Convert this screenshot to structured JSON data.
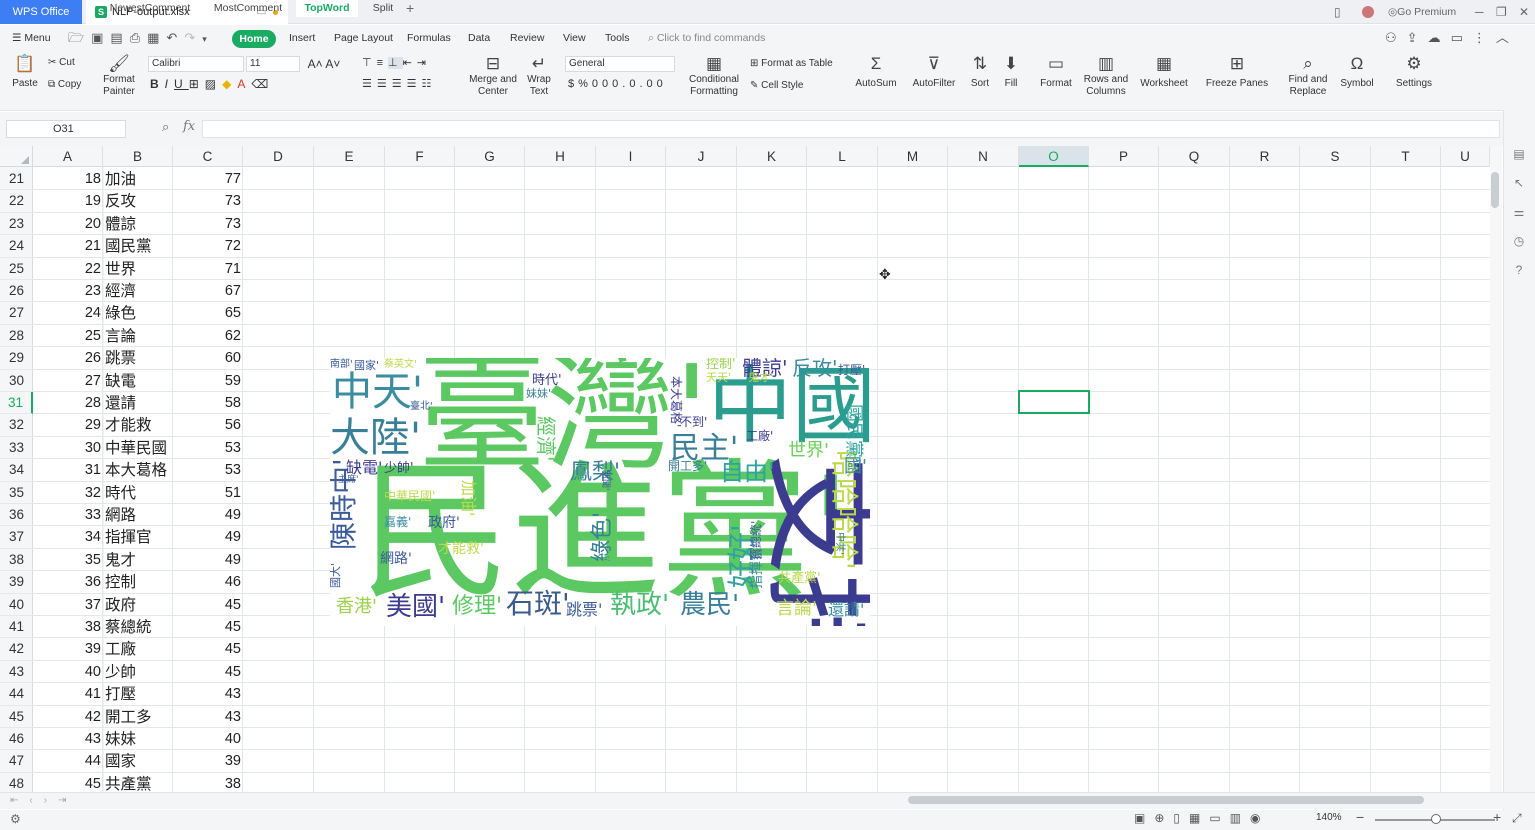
{
  "titlebar": {
    "app_name": "WPS Office",
    "doc_name": "NLP-output.xlsx",
    "new_tab": "+",
    "premium": "Go Premium",
    "win_min": "─",
    "win_max": "❐",
    "win_close": "✕"
  },
  "menubar": {
    "menu_label": "Menu",
    "tabs": [
      "Home",
      "Insert",
      "Page Layout",
      "Formulas",
      "Data",
      "Review",
      "View",
      "Tools"
    ],
    "search_placeholder": "Click to find commands"
  },
  "ribbon": {
    "paste": "Paste",
    "cut": "Cut",
    "copy": "Copy",
    "format_painter_1": "Format",
    "format_painter_2": "Painter",
    "font_name": "Calibri",
    "font_size": "11",
    "bold": "B",
    "italic": "I",
    "underline": "U",
    "merge_1": "Merge and",
    "merge_2": "Center",
    "wrap_1": "Wrap",
    "wrap_2": "Text",
    "number_format": "General",
    "cond_fmt_1": "Conditional",
    "cond_fmt_2": "Formatting",
    "format_as_table": "Format as Table",
    "cell_style": "Cell Style",
    "autosum": "AutoSum",
    "autofilter": "AutoFilter",
    "sort": "Sort",
    "fill": "Fill",
    "format": "Format",
    "rows_cols_1": "Rows and",
    "rows_cols_2": "Columns",
    "worksheet": "Worksheet",
    "freeze": "Freeze Panes",
    "find_1": "Find and",
    "find_2": "Replace",
    "symbol": "Symbol",
    "settings": "Settings"
  },
  "formula_bar": {
    "name_box": "O31",
    "fx": "fx",
    "formula": ""
  },
  "columns": [
    "A",
    "B",
    "C",
    "D",
    "E",
    "F",
    "G",
    "H",
    "I",
    "J",
    "K",
    "L",
    "M",
    "N",
    "O",
    "P",
    "Q",
    "R",
    "S",
    "T",
    "U"
  ],
  "selected_column": "O",
  "selected_row": "31",
  "rows": [
    {
      "row": "21",
      "a": "18",
      "b": "加油",
      "c": "77"
    },
    {
      "row": "22",
      "a": "19",
      "b": "反攻",
      "c": "73"
    },
    {
      "row": "23",
      "a": "20",
      "b": "體諒",
      "c": "73"
    },
    {
      "row": "24",
      "a": "21",
      "b": "國民黨",
      "c": "72"
    },
    {
      "row": "25",
      "a": "22",
      "b": "世界",
      "c": "71"
    },
    {
      "row": "26",
      "a": "23",
      "b": "經濟",
      "c": "67"
    },
    {
      "row": "27",
      "a": "24",
      "b": "綠色",
      "c": "65"
    },
    {
      "row": "28",
      "a": "25",
      "b": "言論",
      "c": "62"
    },
    {
      "row": "29",
      "a": "26",
      "b": "跳票",
      "c": "60"
    },
    {
      "row": "30",
      "a": "27",
      "b": "缺電",
      "c": "59"
    },
    {
      "row": "31",
      "a": "28",
      "b": "還請",
      "c": "58"
    },
    {
      "row": "32",
      "a": "29",
      "b": "才能救",
      "c": "56"
    },
    {
      "row": "33",
      "a": "30",
      "b": "中華民國",
      "c": "53"
    },
    {
      "row": "34",
      "a": "31",
      "b": "本大葛格",
      "c": "53"
    },
    {
      "row": "35",
      "a": "32",
      "b": "時代",
      "c": "51"
    },
    {
      "row": "36",
      "a": "33",
      "b": "網路",
      "c": "49"
    },
    {
      "row": "37",
      "a": "34",
      "b": "指揮官",
      "c": "49"
    },
    {
      "row": "38",
      "a": "35",
      "b": "鬼才",
      "c": "49"
    },
    {
      "row": "39",
      "a": "36",
      "b": "控制",
      "c": "46"
    },
    {
      "row": "40",
      "a": "37",
      "b": "政府",
      "c": "45"
    },
    {
      "row": "41",
      "a": "38",
      "b": "蔡總統",
      "c": "45"
    },
    {
      "row": "42",
      "a": "39",
      "b": "工廠",
      "c": "45"
    },
    {
      "row": "43",
      "a": "40",
      "b": "少帥",
      "c": "45"
    },
    {
      "row": "44",
      "a": "41",
      "b": "打壓",
      "c": "43"
    },
    {
      "row": "45",
      "a": "42",
      "b": "開工多",
      "c": "43"
    },
    {
      "row": "46",
      "a": "43",
      "b": "妹妹",
      "c": "40"
    },
    {
      "row": "47",
      "a": "44",
      "b": "國家",
      "c": "39"
    },
    {
      "row": "48",
      "a": "45",
      "b": "共產黨",
      "c": "38"
    }
  ],
  "wordcloud": {
    "words": [
      {
        "t": "臺灣'",
        "c": "#5bc862"
      },
      {
        "t": "民進黨'",
        "c": "#5bc862"
      },
      {
        "t": "中國'",
        "c": "#2a9d8f"
      },
      {
        "t": "支持'",
        "c": "#3b3b8f"
      },
      {
        "t": "大陸'",
        "c": "#3a7f9a"
      },
      {
        "t": "中天'",
        "c": "#3a8ca0"
      },
      {
        "t": "民主'",
        "c": "#3a7f9a"
      },
      {
        "t": "自由'",
        "c": "#2fa3a0"
      },
      {
        "t": "哈哈哈哈'",
        "c": "#bcd94b"
      },
      {
        "t": "好好'",
        "c": "#2fa3a0"
      },
      {
        "t": "陳時中'",
        "c": "#3b5b9a"
      },
      {
        "t": "石斑'",
        "c": "#3a5a8a"
      },
      {
        "t": "農民'",
        "c": "#3a7f9a"
      },
      {
        "t": "執政'",
        "c": "#4bbd72"
      },
      {
        "t": "美國'",
        "c": "#3b3b8f"
      },
      {
        "t": "修理'",
        "c": "#5bc862"
      },
      {
        "t": "香港'",
        "c": "#9cd34b"
      },
      {
        "t": "鳳梨'",
        "c": "#3a7f9a"
      },
      {
        "t": "體諒'",
        "c": "#3b3b8f"
      },
      {
        "t": "反攻'",
        "c": "#3a8ca0"
      },
      {
        "t": "世界'",
        "c": "#6fcf5a"
      },
      {
        "t": "言論'",
        "c": "#bcd94b"
      },
      {
        "t": "還請'",
        "c": "#3a8ca0"
      },
      {
        "t": "跳票'",
        "c": "#3b5b9a"
      },
      {
        "t": "綠色'",
        "c": "#3a7f9a"
      },
      {
        "t": "缺電'",
        "c": "#3b3b8f"
      },
      {
        "t": "網路'",
        "c": "#3b5b9a"
      },
      {
        "t": "加油'",
        "c": "#bcd94b"
      },
      {
        "t": "政府'",
        "c": "#3b5b9a"
      },
      {
        "t": "才能救'",
        "c": "#bcd94b"
      },
      {
        "t": "中華民國'",
        "c": "#bcd94b"
      },
      {
        "t": "時代'",
        "c": "#3b3b8f"
      },
      {
        "t": "控制'",
        "c": "#9cd34b"
      },
      {
        "t": "打壓'",
        "c": "#3b5b9a"
      },
      {
        "t": "工廠'",
        "c": "#3b3b8f"
      },
      {
        "t": "開工多'",
        "c": "#3a7f9a"
      },
      {
        "t": "國家'",
        "c": "#3b5b9a"
      },
      {
        "t": "南部'",
        "c": "#3b5b9a"
      },
      {
        "t": "蔡英文'",
        "c": "#bcd94b"
      },
      {
        "t": "妹妹'",
        "c": "#3a7f9a"
      },
      {
        "t": "臺北'",
        "c": "#3b5b9a"
      },
      {
        "t": "少帥'",
        "c": "#3b3b8f"
      },
      {
        "t": "主席'",
        "c": "#3b5b9a"
      },
      {
        "t": "鬼才'",
        "c": "#bcd94b"
      },
      {
        "t": "國民黨'",
        "c": "#2fa3a0"
      },
      {
        "t": "共產黨'",
        "c": "#bcd94b"
      },
      {
        "t": "指揮官'",
        "c": "#3a8ca0"
      },
      {
        "t": "蔡總統'",
        "c": "#3b5b9a"
      },
      {
        "t": "本大葛格'",
        "c": "#3b3b8f"
      },
      {
        "t": "不到'",
        "c": "#3b3b8f"
      },
      {
        "t": "天天'",
        "c": "#bcd94b"
      },
      {
        "t": "中共'",
        "c": "#3a7f9a"
      },
      {
        "t": "新聞'",
        "c": "#3b5b9a"
      },
      {
        "t": "經濟'",
        "c": "#5bc862"
      },
      {
        "t": "國'",
        "c": "#3a8ca0"
      },
      {
        "t": "國大'",
        "c": "#3b5b9a"
      },
      {
        "t": "無'",
        "c": "#5bc862"
      },
      {
        "t": "嘉義'",
        "c": "#3a8ca0"
      }
    ]
  },
  "sheets": [
    "NewestComment",
    "MostComment",
    "TopWord",
    "Split"
  ],
  "active_sheet": "TopWord",
  "add_sheet": "+",
  "status": {
    "zoom": "140%",
    "zoom_out": "−",
    "zoom_in": "+"
  }
}
